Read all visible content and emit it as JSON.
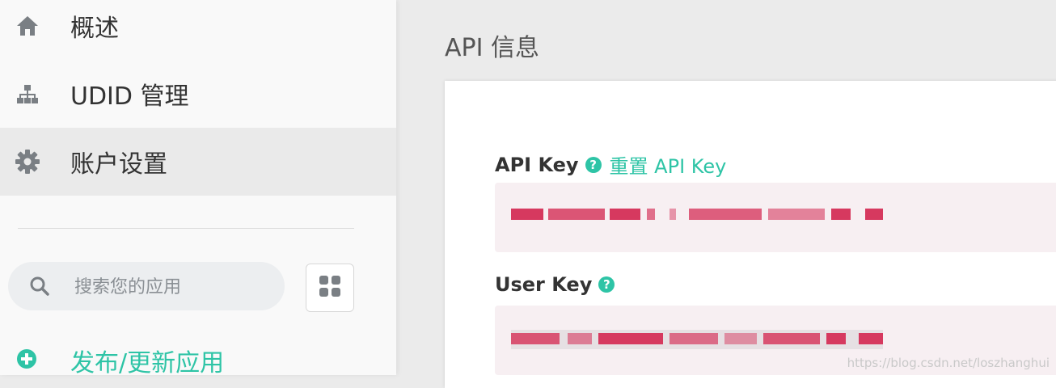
{
  "sidebar": {
    "items": [
      {
        "label": "概述",
        "icon": "home-icon",
        "active": false
      },
      {
        "label": "UDID 管理",
        "icon": "sitemap-icon",
        "active": false
      },
      {
        "label": "账户设置",
        "icon": "gear-icon",
        "active": true
      }
    ],
    "search": {
      "placeholder": "搜索您的应用",
      "icon": "search-icon"
    },
    "grid_button_icon": "grid-icon",
    "publish": {
      "label": "发布/更新应用",
      "icon": "plus-circle-icon"
    }
  },
  "main": {
    "title": "API 信息",
    "api_key": {
      "label": "API Key",
      "help_icon": "?",
      "reset_label": "重置 API Key",
      "value": ""
    },
    "user_key": {
      "label": "User Key",
      "help_icon": "?",
      "value": ""
    }
  },
  "watermark": "https://blog.csdn.net/loszhanghui",
  "colors": {
    "accent": "#2ec4a6",
    "masked_text": "#d6395f",
    "key_bg": "#f7eff2",
    "active_bg": "#eaeaea"
  }
}
